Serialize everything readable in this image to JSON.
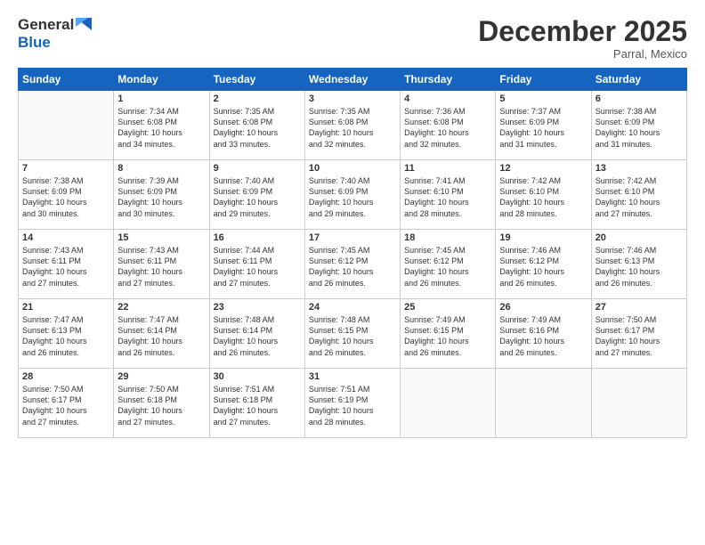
{
  "logo": {
    "line1": "General",
    "line2": "Blue"
  },
  "title": "December 2025",
  "subtitle": "Parral, Mexico",
  "weekdays": [
    "Sunday",
    "Monday",
    "Tuesday",
    "Wednesday",
    "Thursday",
    "Friday",
    "Saturday"
  ],
  "weeks": [
    [
      {
        "day": "",
        "detail": ""
      },
      {
        "day": "1",
        "detail": "Sunrise: 7:34 AM\nSunset: 6:08 PM\nDaylight: 10 hours\nand 34 minutes."
      },
      {
        "day": "2",
        "detail": "Sunrise: 7:35 AM\nSunset: 6:08 PM\nDaylight: 10 hours\nand 33 minutes."
      },
      {
        "day": "3",
        "detail": "Sunrise: 7:35 AM\nSunset: 6:08 PM\nDaylight: 10 hours\nand 32 minutes."
      },
      {
        "day": "4",
        "detail": "Sunrise: 7:36 AM\nSunset: 6:08 PM\nDaylight: 10 hours\nand 32 minutes."
      },
      {
        "day": "5",
        "detail": "Sunrise: 7:37 AM\nSunset: 6:09 PM\nDaylight: 10 hours\nand 31 minutes."
      },
      {
        "day": "6",
        "detail": "Sunrise: 7:38 AM\nSunset: 6:09 PM\nDaylight: 10 hours\nand 31 minutes."
      }
    ],
    [
      {
        "day": "7",
        "detail": "Sunrise: 7:38 AM\nSunset: 6:09 PM\nDaylight: 10 hours\nand 30 minutes."
      },
      {
        "day": "8",
        "detail": "Sunrise: 7:39 AM\nSunset: 6:09 PM\nDaylight: 10 hours\nand 30 minutes."
      },
      {
        "day": "9",
        "detail": "Sunrise: 7:40 AM\nSunset: 6:09 PM\nDaylight: 10 hours\nand 29 minutes."
      },
      {
        "day": "10",
        "detail": "Sunrise: 7:40 AM\nSunset: 6:09 PM\nDaylight: 10 hours\nand 29 minutes."
      },
      {
        "day": "11",
        "detail": "Sunrise: 7:41 AM\nSunset: 6:10 PM\nDaylight: 10 hours\nand 28 minutes."
      },
      {
        "day": "12",
        "detail": "Sunrise: 7:42 AM\nSunset: 6:10 PM\nDaylight: 10 hours\nand 28 minutes."
      },
      {
        "day": "13",
        "detail": "Sunrise: 7:42 AM\nSunset: 6:10 PM\nDaylight: 10 hours\nand 27 minutes."
      }
    ],
    [
      {
        "day": "14",
        "detail": "Sunrise: 7:43 AM\nSunset: 6:11 PM\nDaylight: 10 hours\nand 27 minutes."
      },
      {
        "day": "15",
        "detail": "Sunrise: 7:43 AM\nSunset: 6:11 PM\nDaylight: 10 hours\nand 27 minutes."
      },
      {
        "day": "16",
        "detail": "Sunrise: 7:44 AM\nSunset: 6:11 PM\nDaylight: 10 hours\nand 27 minutes."
      },
      {
        "day": "17",
        "detail": "Sunrise: 7:45 AM\nSunset: 6:12 PM\nDaylight: 10 hours\nand 26 minutes."
      },
      {
        "day": "18",
        "detail": "Sunrise: 7:45 AM\nSunset: 6:12 PM\nDaylight: 10 hours\nand 26 minutes."
      },
      {
        "day": "19",
        "detail": "Sunrise: 7:46 AM\nSunset: 6:12 PM\nDaylight: 10 hours\nand 26 minutes."
      },
      {
        "day": "20",
        "detail": "Sunrise: 7:46 AM\nSunset: 6:13 PM\nDaylight: 10 hours\nand 26 minutes."
      }
    ],
    [
      {
        "day": "21",
        "detail": "Sunrise: 7:47 AM\nSunset: 6:13 PM\nDaylight: 10 hours\nand 26 minutes."
      },
      {
        "day": "22",
        "detail": "Sunrise: 7:47 AM\nSunset: 6:14 PM\nDaylight: 10 hours\nand 26 minutes."
      },
      {
        "day": "23",
        "detail": "Sunrise: 7:48 AM\nSunset: 6:14 PM\nDaylight: 10 hours\nand 26 minutes."
      },
      {
        "day": "24",
        "detail": "Sunrise: 7:48 AM\nSunset: 6:15 PM\nDaylight: 10 hours\nand 26 minutes."
      },
      {
        "day": "25",
        "detail": "Sunrise: 7:49 AM\nSunset: 6:15 PM\nDaylight: 10 hours\nand 26 minutes."
      },
      {
        "day": "26",
        "detail": "Sunrise: 7:49 AM\nSunset: 6:16 PM\nDaylight: 10 hours\nand 26 minutes."
      },
      {
        "day": "27",
        "detail": "Sunrise: 7:50 AM\nSunset: 6:17 PM\nDaylight: 10 hours\nand 27 minutes."
      }
    ],
    [
      {
        "day": "28",
        "detail": "Sunrise: 7:50 AM\nSunset: 6:17 PM\nDaylight: 10 hours\nand 27 minutes."
      },
      {
        "day": "29",
        "detail": "Sunrise: 7:50 AM\nSunset: 6:18 PM\nDaylight: 10 hours\nand 27 minutes."
      },
      {
        "day": "30",
        "detail": "Sunrise: 7:51 AM\nSunset: 6:18 PM\nDaylight: 10 hours\nand 27 minutes."
      },
      {
        "day": "31",
        "detail": "Sunrise: 7:51 AM\nSunset: 6:19 PM\nDaylight: 10 hours\nand 28 minutes."
      },
      {
        "day": "",
        "detail": ""
      },
      {
        "day": "",
        "detail": ""
      },
      {
        "day": "",
        "detail": ""
      }
    ]
  ]
}
